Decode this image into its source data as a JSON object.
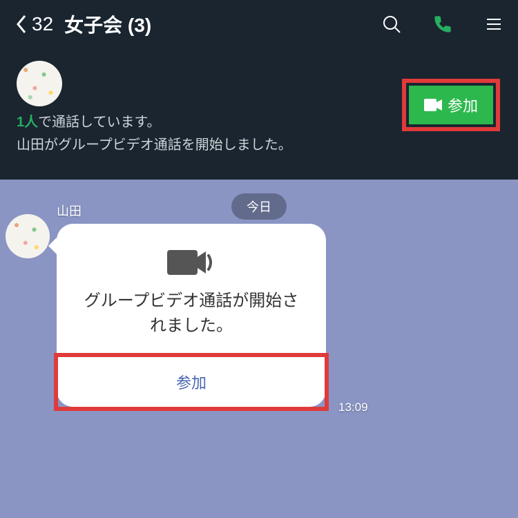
{
  "header": {
    "back_count": "32",
    "title": "女子会 (3)"
  },
  "callbar": {
    "active_count": "1人",
    "status_rest": "で通話しています。",
    "started_by": "山田がグループビデオ通話を開始しました。",
    "join_label": "参加"
  },
  "chat": {
    "date_label": "今日",
    "sender": "山田",
    "bubble_text": "グループビデオ通話が開始されました。",
    "bubble_join": "参加",
    "timestamp": "13:09"
  }
}
